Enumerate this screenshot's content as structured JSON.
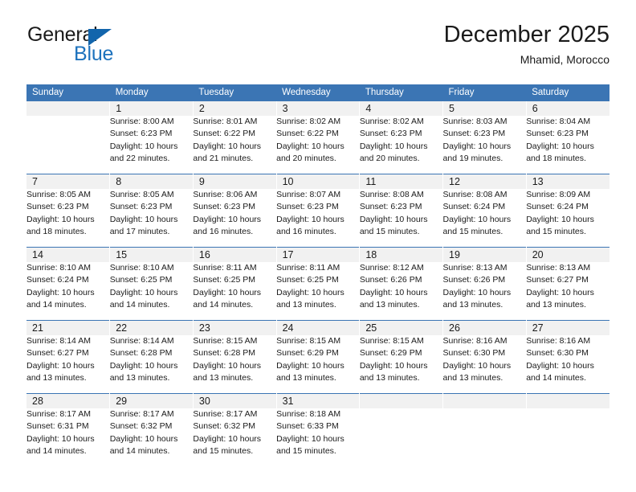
{
  "logo": {
    "word_top": "General",
    "word_bottom": "Blue",
    "triangle_icon": "triangle-icon",
    "color_dark": "#1b1b1b",
    "color_blue": "#1d72bd"
  },
  "header": {
    "title": "December 2025",
    "subtitle": "Mhamid, Morocco"
  },
  "theme": {
    "header_blue": "#3b75b4",
    "band_gray": "#f1f1f1",
    "text_dark": "#1b1b1b"
  },
  "calendar": {
    "weekday_headers": [
      "Sunday",
      "Monday",
      "Tuesday",
      "Wednesday",
      "Thursday",
      "Friday",
      "Saturday"
    ],
    "weeks": [
      [
        {
          "day": "",
          "info": ""
        },
        {
          "day": "1",
          "info": "Sunrise: 8:00 AM\nSunset: 6:23 PM\nDaylight: 10 hours\nand 22 minutes."
        },
        {
          "day": "2",
          "info": "Sunrise: 8:01 AM\nSunset: 6:22 PM\nDaylight: 10 hours\nand 21 minutes."
        },
        {
          "day": "3",
          "info": "Sunrise: 8:02 AM\nSunset: 6:22 PM\nDaylight: 10 hours\nand 20 minutes."
        },
        {
          "day": "4",
          "info": "Sunrise: 8:02 AM\nSunset: 6:23 PM\nDaylight: 10 hours\nand 20 minutes."
        },
        {
          "day": "5",
          "info": "Sunrise: 8:03 AM\nSunset: 6:23 PM\nDaylight: 10 hours\nand 19 minutes."
        },
        {
          "day": "6",
          "info": "Sunrise: 8:04 AM\nSunset: 6:23 PM\nDaylight: 10 hours\nand 18 minutes."
        }
      ],
      [
        {
          "day": "7",
          "info": "Sunrise: 8:05 AM\nSunset: 6:23 PM\nDaylight: 10 hours\nand 18 minutes."
        },
        {
          "day": "8",
          "info": "Sunrise: 8:05 AM\nSunset: 6:23 PM\nDaylight: 10 hours\nand 17 minutes."
        },
        {
          "day": "9",
          "info": "Sunrise: 8:06 AM\nSunset: 6:23 PM\nDaylight: 10 hours\nand 16 minutes."
        },
        {
          "day": "10",
          "info": "Sunrise: 8:07 AM\nSunset: 6:23 PM\nDaylight: 10 hours\nand 16 minutes."
        },
        {
          "day": "11",
          "info": "Sunrise: 8:08 AM\nSunset: 6:23 PM\nDaylight: 10 hours\nand 15 minutes."
        },
        {
          "day": "12",
          "info": "Sunrise: 8:08 AM\nSunset: 6:24 PM\nDaylight: 10 hours\nand 15 minutes."
        },
        {
          "day": "13",
          "info": "Sunrise: 8:09 AM\nSunset: 6:24 PM\nDaylight: 10 hours\nand 15 minutes."
        }
      ],
      [
        {
          "day": "14",
          "info": "Sunrise: 8:10 AM\nSunset: 6:24 PM\nDaylight: 10 hours\nand 14 minutes."
        },
        {
          "day": "15",
          "info": "Sunrise: 8:10 AM\nSunset: 6:25 PM\nDaylight: 10 hours\nand 14 minutes."
        },
        {
          "day": "16",
          "info": "Sunrise: 8:11 AM\nSunset: 6:25 PM\nDaylight: 10 hours\nand 14 minutes."
        },
        {
          "day": "17",
          "info": "Sunrise: 8:11 AM\nSunset: 6:25 PM\nDaylight: 10 hours\nand 13 minutes."
        },
        {
          "day": "18",
          "info": "Sunrise: 8:12 AM\nSunset: 6:26 PM\nDaylight: 10 hours\nand 13 minutes."
        },
        {
          "day": "19",
          "info": "Sunrise: 8:13 AM\nSunset: 6:26 PM\nDaylight: 10 hours\nand 13 minutes."
        },
        {
          "day": "20",
          "info": "Sunrise: 8:13 AM\nSunset: 6:27 PM\nDaylight: 10 hours\nand 13 minutes."
        }
      ],
      [
        {
          "day": "21",
          "info": "Sunrise: 8:14 AM\nSunset: 6:27 PM\nDaylight: 10 hours\nand 13 minutes."
        },
        {
          "day": "22",
          "info": "Sunrise: 8:14 AM\nSunset: 6:28 PM\nDaylight: 10 hours\nand 13 minutes."
        },
        {
          "day": "23",
          "info": "Sunrise: 8:15 AM\nSunset: 6:28 PM\nDaylight: 10 hours\nand 13 minutes."
        },
        {
          "day": "24",
          "info": "Sunrise: 8:15 AM\nSunset: 6:29 PM\nDaylight: 10 hours\nand 13 minutes."
        },
        {
          "day": "25",
          "info": "Sunrise: 8:15 AM\nSunset: 6:29 PM\nDaylight: 10 hours\nand 13 minutes."
        },
        {
          "day": "26",
          "info": "Sunrise: 8:16 AM\nSunset: 6:30 PM\nDaylight: 10 hours\nand 13 minutes."
        },
        {
          "day": "27",
          "info": "Sunrise: 8:16 AM\nSunset: 6:30 PM\nDaylight: 10 hours\nand 14 minutes."
        }
      ],
      [
        {
          "day": "28",
          "info": "Sunrise: 8:17 AM\nSunset: 6:31 PM\nDaylight: 10 hours\nand 14 minutes."
        },
        {
          "day": "29",
          "info": "Sunrise: 8:17 AM\nSunset: 6:32 PM\nDaylight: 10 hours\nand 14 minutes."
        },
        {
          "day": "30",
          "info": "Sunrise: 8:17 AM\nSunset: 6:32 PM\nDaylight: 10 hours\nand 15 minutes."
        },
        {
          "day": "31",
          "info": "Sunrise: 8:18 AM\nSunset: 6:33 PM\nDaylight: 10 hours\nand 15 minutes."
        },
        {
          "day": "",
          "info": ""
        },
        {
          "day": "",
          "info": ""
        },
        {
          "day": "",
          "info": ""
        }
      ]
    ]
  }
}
